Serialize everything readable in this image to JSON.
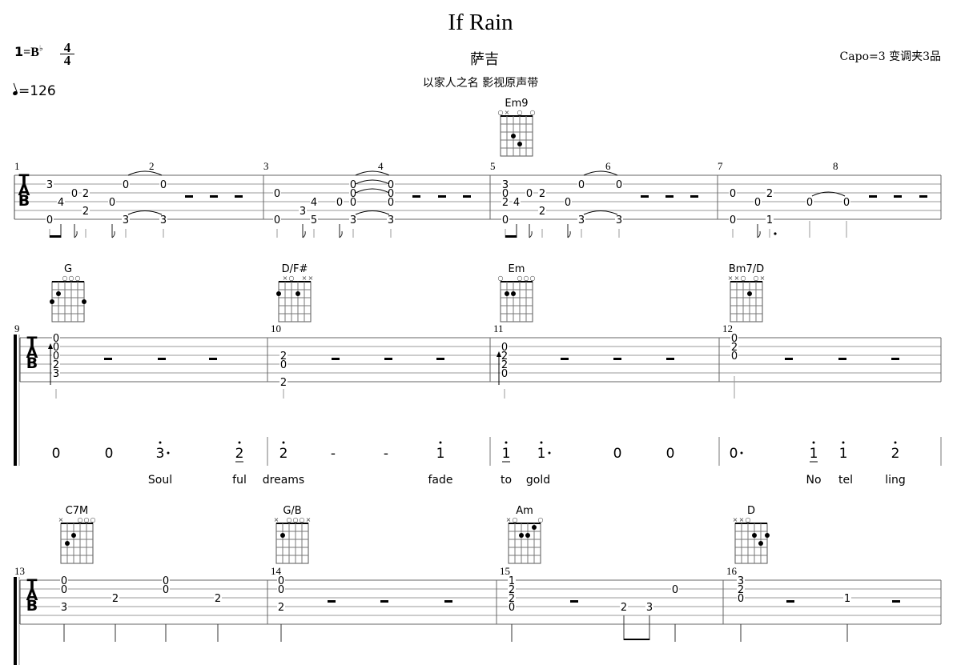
{
  "header": {
    "title": "If Rain",
    "artist": "萨吉",
    "album": "以家人之名 影视原声带",
    "capo": "Capo=3 变调夹3品",
    "key_one": "1",
    "key_eq": "=B",
    "key_flat": "♭",
    "time_sig_num": "4",
    "time_sig_den": "4",
    "tempo": "=126"
  },
  "chords": [
    {
      "name": "Em9",
      "markers": "○×·○·○",
      "dots": [
        [
          4,
          3
        ],
        [
          3,
          4
        ]
      ]
    },
    {
      "name": "G",
      "markers": "··○○○·",
      "dots": [
        [
          5,
          2
        ],
        [
          6,
          3
        ],
        [
          1,
          3
        ]
      ]
    },
    {
      "name": "D/F#",
      "markers": "·×○·××",
      "dots": [
        [
          6,
          2
        ],
        [
          3,
          2
        ]
      ]
    },
    {
      "name": "Em",
      "markers": "○··○○○",
      "dots": [
        [
          5,
          2
        ],
        [
          4,
          2
        ]
      ]
    },
    {
      "name": "Bm7/D",
      "markers": "××○·○×",
      "dots": [
        [
          3,
          2
        ]
      ]
    },
    {
      "name": "C7M",
      "markers": "×··○○○",
      "dots": [
        [
          4,
          2
        ],
        [
          5,
          3
        ]
      ]
    },
    {
      "name": "G/B",
      "markers": "×·○○○×",
      "dots": [
        [
          5,
          2
        ]
      ]
    },
    {
      "name": "Am",
      "markers": "×○···○",
      "dots": [
        [
          2,
          1
        ],
        [
          4,
          2
        ],
        [
          3,
          2
        ]
      ]
    },
    {
      "name": "D",
      "markers": "××○···",
      "dots": [
        [
          3,
          2
        ],
        [
          1,
          2
        ],
        [
          2,
          3
        ]
      ]
    }
  ],
  "systems": [
    {
      "measures": [
        "1",
        "2",
        "3",
        "4",
        "5",
        "6",
        "7",
        "8"
      ],
      "notes": [
        {
          "s": 2,
          "f": "3"
        },
        {
          "s": 6,
          "f": "0"
        },
        {
          "s": 4,
          "f": "4"
        },
        {
          "s": 3,
          "f": "0"
        },
        {
          "s": 3,
          "f": "2"
        },
        {
          "s": 5,
          "f": "2"
        },
        {
          "s": 4,
          "f": "0"
        },
        {
          "s": 2,
          "f": "0"
        },
        {
          "s": 6,
          "f": "3"
        },
        {
          "s": 2,
          "f": "0"
        },
        {
          "s": 6,
          "f": "3"
        },
        {
          "s": 3,
          "f": "0"
        },
        {
          "s": 6,
          "f": "0"
        },
        {
          "s": 5,
          "f": "3"
        },
        {
          "s": 4,
          "f": "4"
        },
        {
          "s": 6,
          "f": "5"
        },
        {
          "s": 4,
          "f": "0"
        },
        {
          "s": 2,
          "f": "0"
        },
        {
          "s": 3,
          "f": "0"
        },
        {
          "s": 4,
          "f": "0"
        },
        {
          "s": 6,
          "f": "3"
        },
        {
          "s": 2,
          "f": "0"
        },
        {
          "s": 3,
          "f": "0"
        },
        {
          "s": 4,
          "f": "0"
        },
        {
          "s": 6,
          "f": "3"
        },
        {
          "s": 2,
          "f": "3"
        },
        {
          "s": 3,
          "f": "0"
        },
        {
          "s": 4,
          "f": "2"
        },
        {
          "s": 6,
          "f": "0"
        },
        {
          "s": 4,
          "f": "4"
        },
        {
          "s": 3,
          "f": "0"
        },
        {
          "s": 3,
          "f": "2"
        },
        {
          "s": 5,
          "f": "2"
        },
        {
          "s": 4,
          "f": "0"
        },
        {
          "s": 2,
          "f": "0"
        },
        {
          "s": 6,
          "f": "3"
        },
        {
          "s": 2,
          "f": "0"
        },
        {
          "s": 6,
          "f": "3"
        },
        {
          "s": 3,
          "f": "0"
        },
        {
          "s": 6,
          "f": "0"
        },
        {
          "s": 4,
          "f": "0"
        },
        {
          "s": 3,
          "f": "2"
        },
        {
          "s": 6,
          "f": "1"
        },
        {
          "s": 4,
          "f": "0"
        },
        {
          "s": 4,
          "f": "0"
        }
      ]
    },
    {
      "measures": [
        "9",
        "10",
        "11",
        "12"
      ],
      "notes": [
        {
          "s": 1,
          "f": "0"
        },
        {
          "s": 2,
          "f": "0"
        },
        {
          "s": 3,
          "f": "0"
        },
        {
          "s": 4,
          "f": "2"
        },
        {
          "s": 5,
          "f": "3"
        },
        {
          "s": 3,
          "f": "2"
        },
        {
          "s": 4,
          "f": "0"
        },
        {
          "s": 6,
          "f": "2"
        },
        {
          "s": 2,
          "f": "0"
        },
        {
          "s": 3,
          "f": "2"
        },
        {
          "s": 4,
          "f": "2"
        },
        {
          "s": 5,
          "f": "0"
        },
        {
          "s": 1,
          "f": "0"
        },
        {
          "s": 2,
          "f": "2"
        },
        {
          "s": 3,
          "f": "0"
        }
      ],
      "jianpu": [
        "0",
        "0",
        "3",
        "2",
        "2",
        "-",
        "-",
        "1",
        "1",
        "1",
        "0",
        "0",
        "0",
        "1",
        "1",
        "2"
      ],
      "lyrics": [
        "Soul",
        "ful",
        "dreams",
        "fade",
        "to",
        "gold",
        "No",
        "tel",
        "ling"
      ]
    },
    {
      "measures": [
        "13",
        "14",
        "15",
        "16"
      ],
      "notes": [
        {
          "s": 1,
          "f": "0"
        },
        {
          "s": 2,
          "f": "0"
        },
        {
          "s": 4,
          "f": "3"
        },
        {
          "s": 3,
          "f": "2"
        },
        {
          "s": 1,
          "f": "0"
        },
        {
          "s": 2,
          "f": "0"
        },
        {
          "s": 3,
          "f": "2"
        },
        {
          "s": 1,
          "f": "0"
        },
        {
          "s": 2,
          "f": "0"
        },
        {
          "s": 4,
          "f": "2"
        },
        {
          "s": 1,
          "f": "1"
        },
        {
          "s": 2,
          "f": "2"
        },
        {
          "s": 3,
          "f": "2"
        },
        {
          "s": 4,
          "f": "0"
        },
        {
          "s": 4,
          "f": "2"
        },
        {
          "s": 4,
          "f": "3"
        },
        {
          "s": 2,
          "f": "0"
        },
        {
          "s": 1,
          "f": "3"
        },
        {
          "s": 2,
          "f": "2"
        },
        {
          "s": 3,
          "f": "0"
        },
        {
          "s": 3,
          "f": "1"
        }
      ]
    }
  ],
  "tab_label": [
    "T",
    "A",
    "B"
  ],
  "rest_symbol": "-"
}
